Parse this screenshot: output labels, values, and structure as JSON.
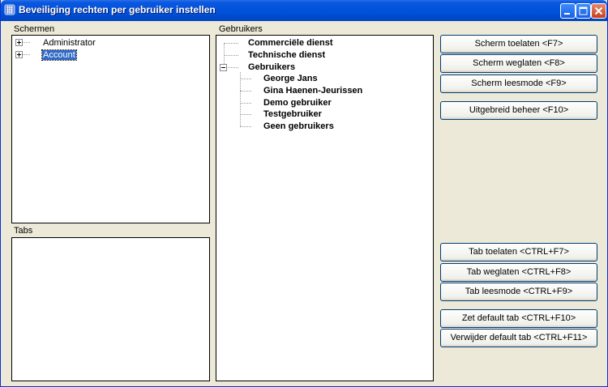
{
  "window": {
    "title": "Beveiliging rechten per gebruiker instellen"
  },
  "schermen": {
    "label": "Schermen",
    "items": [
      {
        "label": "Administrator",
        "selected": false
      },
      {
        "label": "Account",
        "selected": true
      }
    ]
  },
  "tabs": {
    "label": "Tabs"
  },
  "gebruikers": {
    "label": "Gebruikers",
    "groups": [
      {
        "label": "Commerciële dienst"
      },
      {
        "label": "Technische dienst"
      },
      {
        "label": "Gebruikers"
      }
    ],
    "users": [
      {
        "label": "George Jans"
      },
      {
        "label": "Gina Haenen-Jeurissen"
      },
      {
        "label": "Demo gebruiker"
      },
      {
        "label": "Testgebruiker"
      },
      {
        "label": "Geen gebruikers"
      }
    ]
  },
  "buttons": {
    "scherm_toelaten": "Scherm toelaten <F7>",
    "scherm_weglaten": "Scherm weglaten <F8>",
    "scherm_leesmode": "Scherm leesmode <F9>",
    "uitgebreid_beheer": "Uitgebreid beheer <F10>",
    "tab_toelaten": "Tab toelaten <CTRL+F7>",
    "tab_weglaten": "Tab weglaten <CTRL+F8>",
    "tab_leesmode": "Tab leesmode <CTRL+F9>",
    "zet_default_tab": "Zet default tab <CTRL+F10>",
    "verwijder_default_tab": "Verwijder default tab <CTRL+F11>"
  },
  "icons": {
    "app": "app-icon",
    "minimize": "minimize-icon",
    "maximize": "maximize-icon",
    "close": "close-icon"
  },
  "colors": {
    "titlebar": "#0050d8",
    "selection": "#316ac5",
    "close": "#c6401c"
  }
}
